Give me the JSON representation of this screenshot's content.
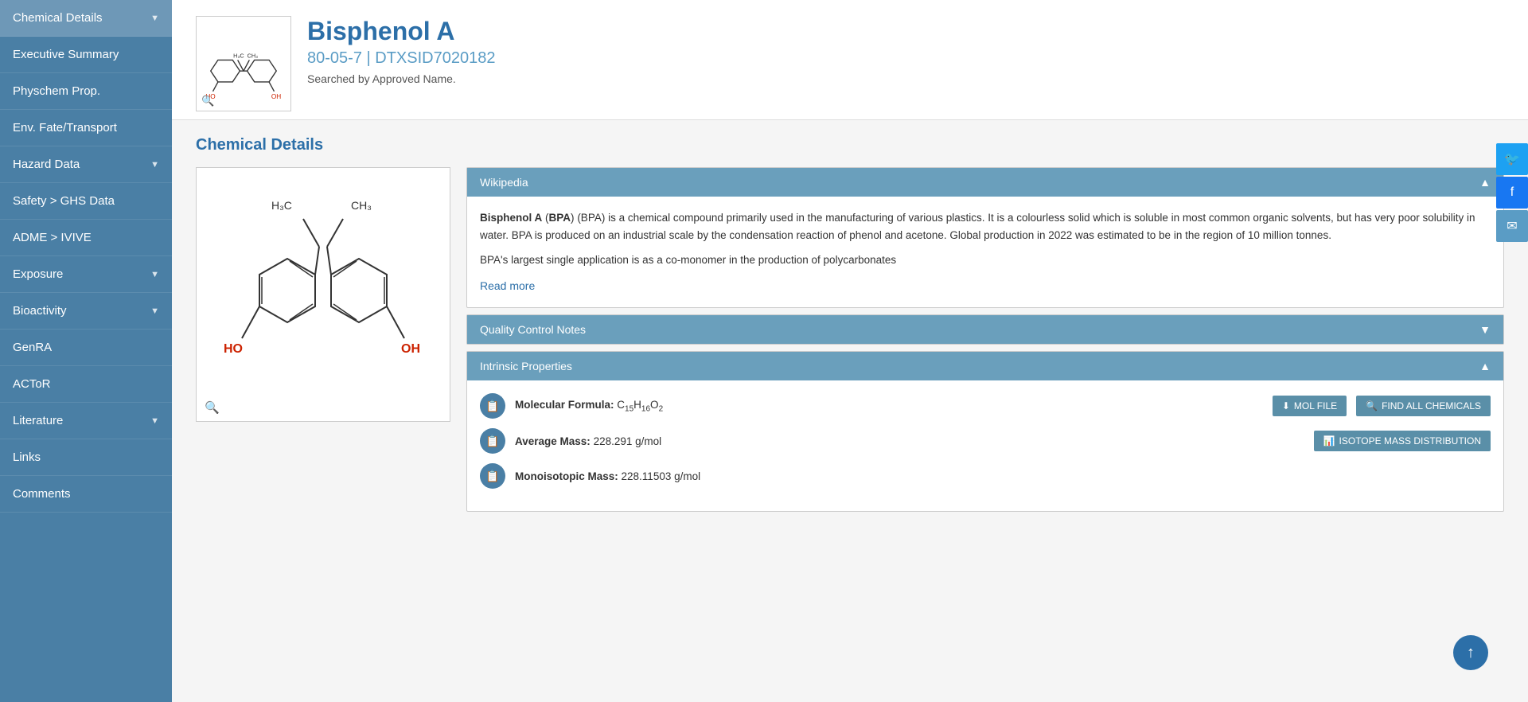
{
  "sidebar": {
    "items": [
      {
        "label": "Chemical Details",
        "active": true,
        "hasArrow": true
      },
      {
        "label": "Executive Summary",
        "active": false,
        "hasArrow": false
      },
      {
        "label": "Physchem Prop.",
        "active": false,
        "hasArrow": false
      },
      {
        "label": "Env. Fate/Transport",
        "active": false,
        "hasArrow": false
      },
      {
        "label": "Hazard Data",
        "active": false,
        "hasArrow": true
      },
      {
        "label": "Safety > GHS Data",
        "active": false,
        "hasArrow": false
      },
      {
        "label": "ADME > IVIVE",
        "active": false,
        "hasArrow": false
      },
      {
        "label": "Exposure",
        "active": false,
        "hasArrow": true
      },
      {
        "label": "Bioactivity",
        "active": false,
        "hasArrow": true
      },
      {
        "label": "GenRA",
        "active": false,
        "hasArrow": false
      },
      {
        "label": "ACToR",
        "active": false,
        "hasArrow": false
      },
      {
        "label": "Literature",
        "active": false,
        "hasArrow": true
      },
      {
        "label": "Links",
        "active": false,
        "hasArrow": false
      },
      {
        "label": "Comments",
        "active": false,
        "hasArrow": false
      }
    ]
  },
  "header": {
    "chemical_name": "Bisphenol A",
    "chemical_id": "80-05-7 | DTXSID7020182",
    "searched_by": "Searched by Approved Name."
  },
  "content": {
    "section_title": "Chemical Details",
    "wikipedia_panel": {
      "title": "Wikipedia",
      "expanded": true,
      "text1": " (BPA) is a chemical compound primarily used in the manufacturing of various plastics. It is a colourless solid which is soluble in most common organic solvents, but has very poor solubility in water. BPA is produced on an industrial scale by the condensation reaction of phenol and acetone. Global production in 2022 was estimated to be in the region of 10 million tonnes.",
      "bold1": "Bisphenol A",
      "bold2": "BPA",
      "text2": "BPA's largest single application is as a co-monomer in the production of polycarbonates",
      "read_more": "Read more"
    },
    "quality_panel": {
      "title": "Quality Control Notes",
      "expanded": false
    },
    "intrinsic_panel": {
      "title": "Intrinsic Properties",
      "expanded": true,
      "mol_formula_label": "Molecular Formula:",
      "mol_formula": "C",
      "mol_formula_sub1": "15",
      "mol_formula_mid": "H",
      "mol_formula_sub2": "16",
      "mol_formula_end": "O",
      "mol_formula_sub3": "2",
      "mol_file_btn": "MOL FILE",
      "find_all_btn": "FIND ALL CHEMICALS",
      "avg_mass_label": "Average Mass:",
      "avg_mass_value": "228.291 g/mol",
      "isotope_btn": "ISOTOPE MASS DISTRIBUTION",
      "mono_mass_label": "Monoisotopic Mass:",
      "mono_mass_value": "228.11503 g/mol"
    }
  },
  "social": {
    "twitter_label": "Twitter",
    "facebook_label": "Facebook",
    "email_label": "Email"
  },
  "scroll_top_label": "↑"
}
